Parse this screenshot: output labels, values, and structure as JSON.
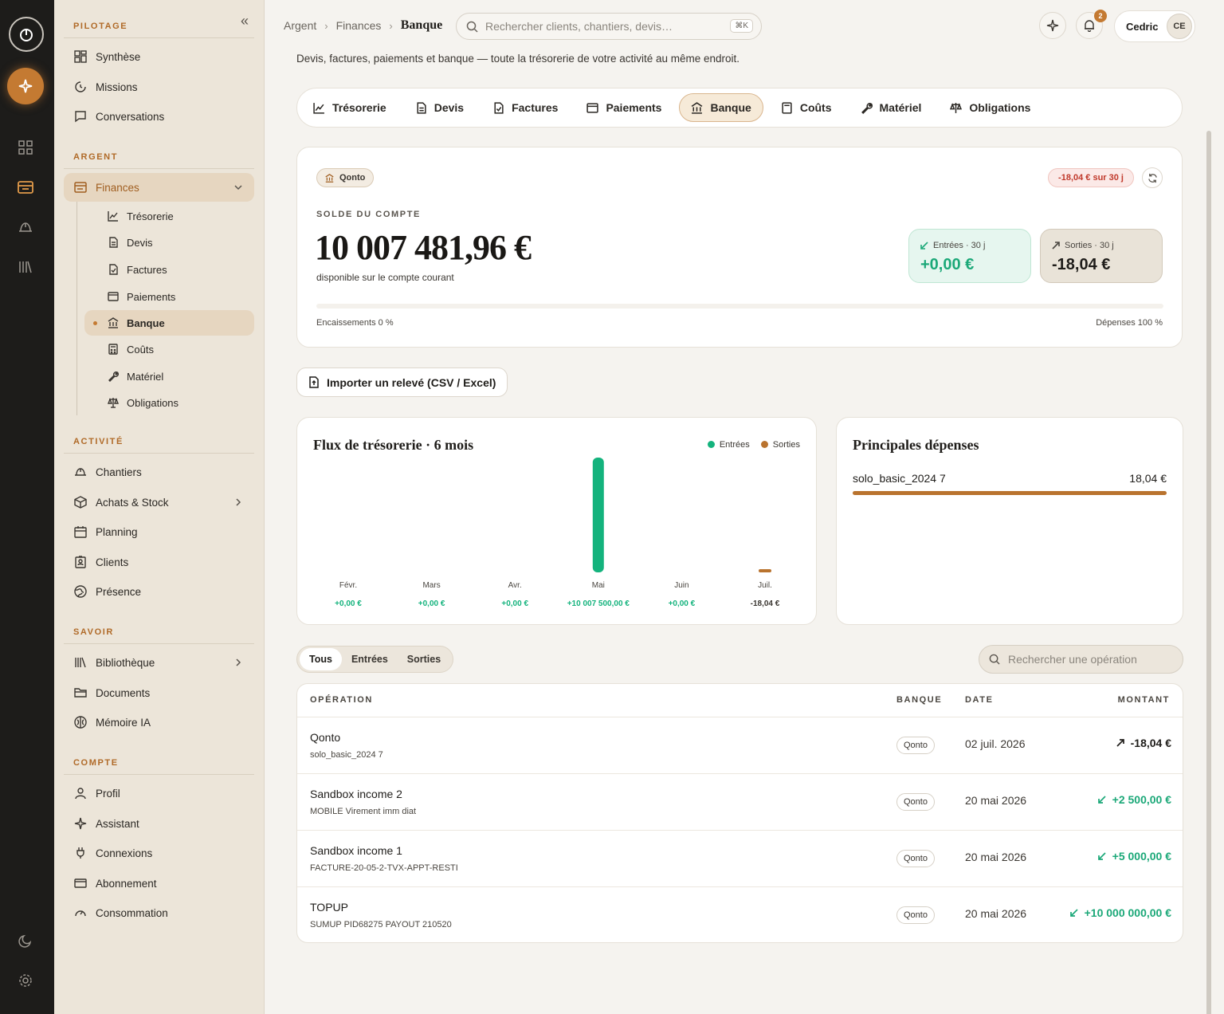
{
  "sidebar": {
    "sections": {
      "pilotage": "PILOTAGE",
      "argent": "ARGENT",
      "activite": "ACTIVITÉ",
      "savoir": "SAVOIR",
      "compte": "COMPTE"
    },
    "pilotage": [
      "Synthèse",
      "Missions",
      "Conversations"
    ],
    "finances": "Finances",
    "finances_sub": [
      "Trésorerie",
      "Devis",
      "Factures",
      "Paiements",
      "Banque",
      "Coûts",
      "Matériel",
      "Obligations"
    ],
    "activite": [
      "Chantiers",
      "Achats & Stock",
      "Planning",
      "Clients",
      "Présence"
    ],
    "savoir": [
      "Bibliothèque",
      "Documents",
      "Mémoire IA"
    ],
    "compte": [
      "Profil",
      "Assistant",
      "Connexions",
      "Abonnement",
      "Consommation"
    ]
  },
  "topbar": {
    "breadcrumb": [
      "Argent",
      "Finances",
      "Banque"
    ],
    "search_placeholder": "Rechercher clients, chantiers, devis…",
    "search_shortcut": "⌘K",
    "notifications_count": "2",
    "user_name": "Cedric",
    "user_initials": "CE"
  },
  "intro": "Devis, factures, paiements et banque — toute la trésorerie de votre activité au même endroit.",
  "tabs": [
    "Trésorerie",
    "Devis",
    "Factures",
    "Paiements",
    "Banque",
    "Coûts",
    "Matériel",
    "Obligations"
  ],
  "account": {
    "bank": "Qonto",
    "delta_badge": "-18,04 € sur 30 j",
    "balance_label": "SOLDE DU COMPTE",
    "balance": "10 007 481,96 €",
    "balance_sub": "disponible sur le compte courant",
    "in_label": "Entrées · 30 j",
    "in_value": "+0,00 €",
    "out_label": "Sorties · 30 j",
    "out_value": "-18,04 €",
    "encaissements": "Encaissements 0 %",
    "depenses": "Dépenses 100 %"
  },
  "import_label": "Importer un relevé (CSV / Excel)",
  "cashflow": {
    "title": "Flux de trésorerie · 6 mois",
    "legend_in": "Entrées",
    "legend_out": "Sorties",
    "in_color": "#14b37d",
    "out_color": "#b9732e"
  },
  "chart_data": {
    "type": "bar",
    "title": "Flux de trésorerie · 6 mois",
    "categories": [
      "Févr.",
      "Mars",
      "Avr.",
      "Mai",
      "Juin",
      "Juil."
    ],
    "series": [
      {
        "name": "Entrées",
        "values": [
          0,
          0,
          0,
          10007500,
          0,
          0
        ]
      },
      {
        "name": "Sorties",
        "values": [
          0,
          0,
          0,
          0,
          0,
          18.04
        ]
      }
    ],
    "net_labels": [
      "+0,00 €",
      "+0,00 €",
      "+0,00 €",
      "+10 007 500,00 €",
      "+0,00 €",
      "-18,04 €"
    ],
    "legend": "top-right",
    "grid": false
  },
  "expenses": {
    "title": "Principales dépenses",
    "items": [
      {
        "label": "solo_basic_2024 7",
        "amount": "18,04 €",
        "share": 1.0
      }
    ]
  },
  "filters": [
    "Tous",
    "Entrées",
    "Sorties"
  ],
  "op_search_placeholder": "Rechercher une opération",
  "table": {
    "headers": [
      "OPÉRATION",
      "BANQUE",
      "DATE",
      "MONTANT"
    ],
    "rows": [
      {
        "title": "Qonto",
        "sub": "solo_basic_2024 7",
        "bank": "Qonto",
        "date": "02 juil. 2026",
        "amount": "-18,04 €",
        "dir": "out"
      },
      {
        "title": "Sandbox income 2",
        "sub": "MOBILE Virement imm diat",
        "bank": "Qonto",
        "date": "20 mai 2026",
        "amount": "+2 500,00 €",
        "dir": "in"
      },
      {
        "title": "Sandbox income 1",
        "sub": "FACTURE-20-05-2-TVX-APPT-RESTI",
        "bank": "Qonto",
        "date": "20 mai 2026",
        "amount": "+5 000,00 €",
        "dir": "in"
      },
      {
        "title": "TOPUP",
        "sub": "SUMUP PID68275 PAYOUT 210520",
        "bank": "Qonto",
        "date": "20 mai 2026",
        "amount": "+10 000 000,00 €",
        "dir": "in"
      }
    ]
  }
}
